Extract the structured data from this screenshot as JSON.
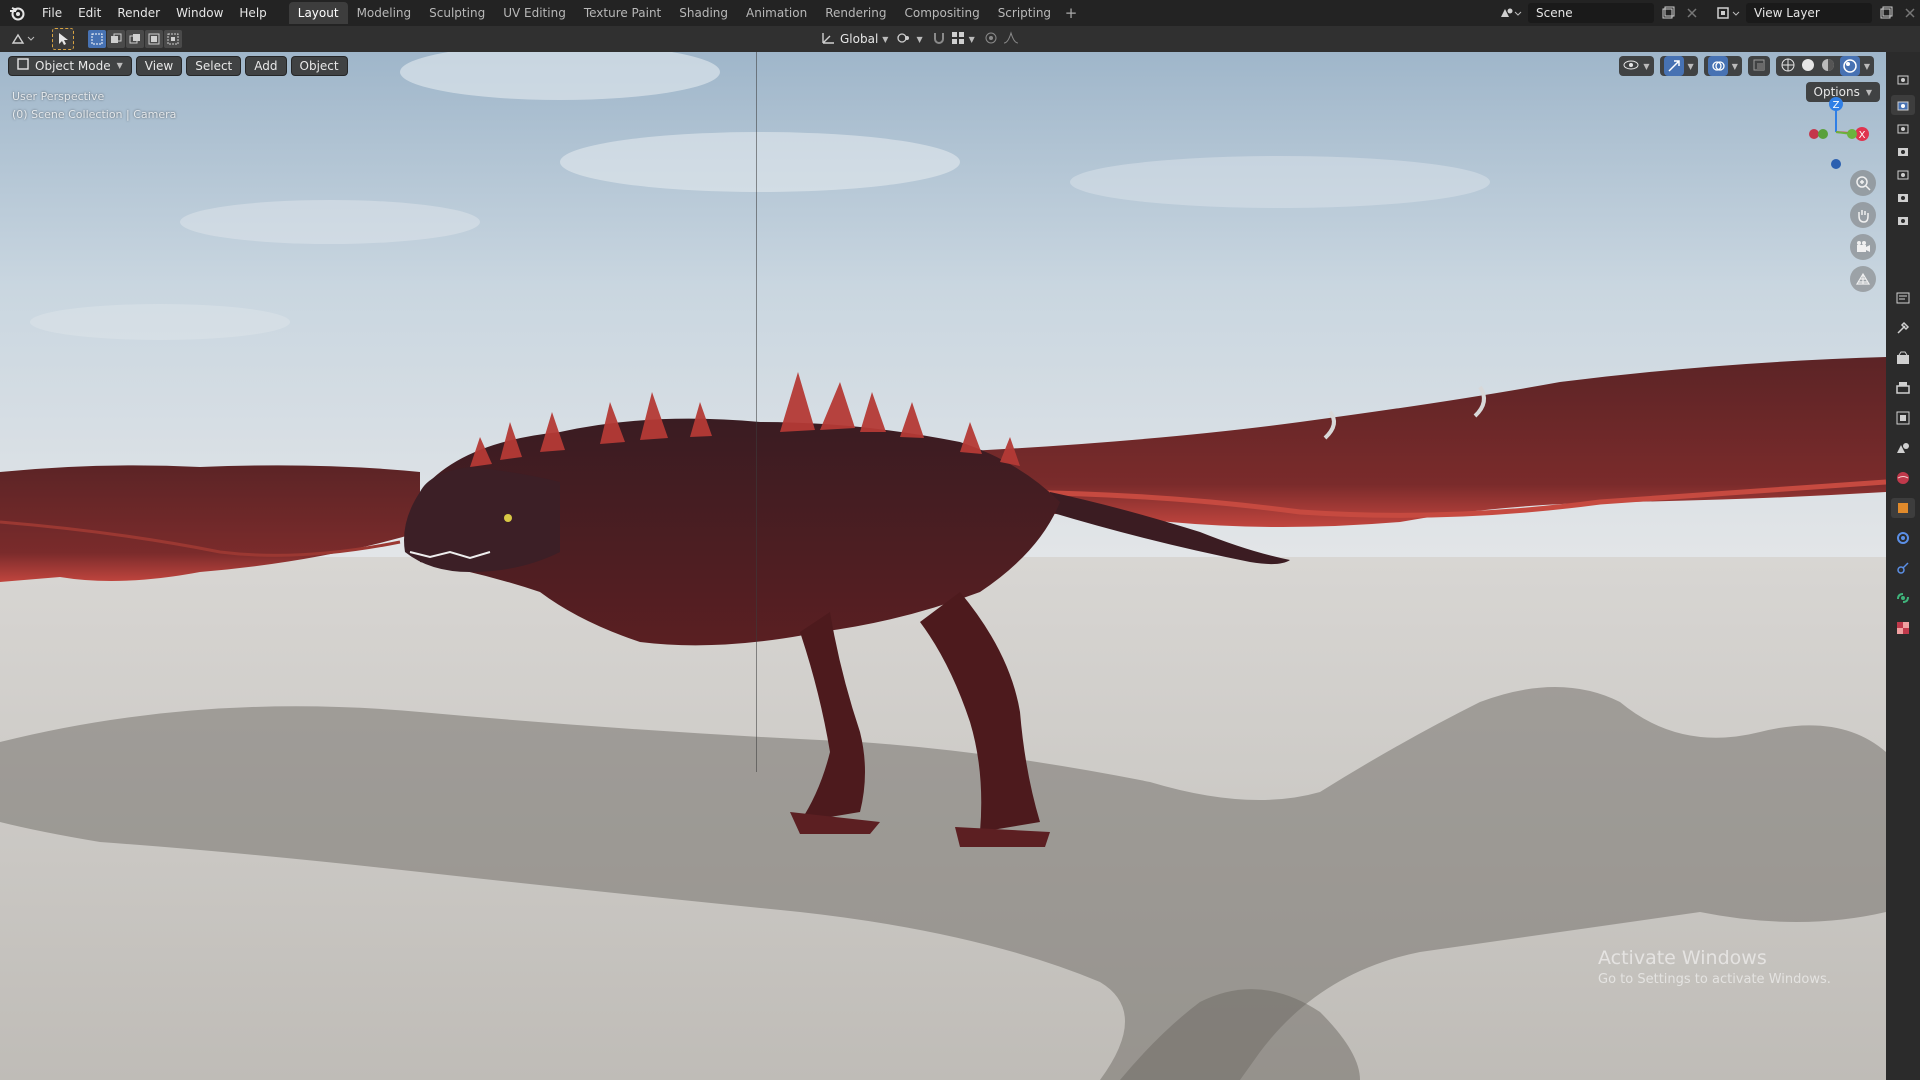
{
  "menu": [
    "File",
    "Edit",
    "Render",
    "Window",
    "Help"
  ],
  "workspaces": [
    {
      "label": "Layout",
      "active": true
    },
    {
      "label": "Modeling",
      "active": false
    },
    {
      "label": "Sculpting",
      "active": false
    },
    {
      "label": "UV Editing",
      "active": false
    },
    {
      "label": "Texture Paint",
      "active": false
    },
    {
      "label": "Shading",
      "active": false
    },
    {
      "label": "Animation",
      "active": false
    },
    {
      "label": "Rendering",
      "active": false
    },
    {
      "label": "Compositing",
      "active": false
    },
    {
      "label": "Scripting",
      "active": false
    }
  ],
  "workspace_add": "+",
  "scene": {
    "name": "Scene"
  },
  "view_layer": {
    "name": "View Layer"
  },
  "toolbar": {
    "orientation": "Global"
  },
  "viewport": {
    "mode": "Object Mode",
    "menus": [
      "View",
      "Select",
      "Add",
      "Object"
    ],
    "info_line1": "User Perspective",
    "info_line2": "(0) Scene Collection | Camera",
    "options_label": "Options",
    "gizmo_axes": {
      "z": "Z",
      "x": "X"
    }
  },
  "watermark": {
    "title": "Activate Windows",
    "subtitle": "Go to Settings to activate Windows."
  },
  "colors": {
    "accent": "#4772b3",
    "axis_x": "#e0344f",
    "axis_y": "#6bb33d",
    "axis_z": "#2f7fe6",
    "sky_top": "#a8bfd2",
    "ground": "#c8c6c2",
    "dragon": "#4a1a1c"
  },
  "icons": {
    "logo": "blender-logo-icon",
    "select": "select-box-icon",
    "zoom": "zoom-icon",
    "pan": "hand-icon",
    "camera": "camera-view-icon",
    "grid": "ortho-grid-icon"
  }
}
